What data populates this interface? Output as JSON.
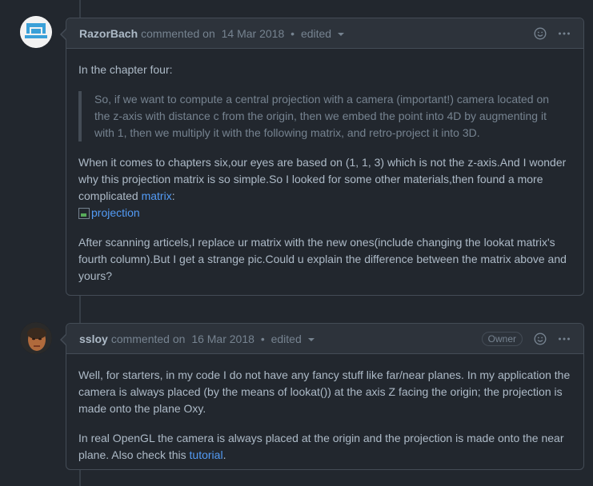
{
  "comments": [
    {
      "author": "RazorBach",
      "action": "commented on",
      "date": "14 Mar 2018",
      "separator": "•",
      "edited": "edited",
      "body": {
        "intro": "In the chapter four:",
        "quote": "So, if we want to compute a central projection with a camera (important!) camera located on the z-axis with distance c from the origin, then we embed the point into 4D by augmenting it with 1, then we multiply it with the following matrix, and retro-project it into 3D.",
        "para2_text": "When it comes to chapters six,our eyes are based on (1, 1, 3) which is not the z-axis.And I wonder why this projection matrix is so simple.So I looked for some other materials,then found a more complicated ",
        "para2_link": "matrix",
        "para2_end": ":",
        "image_alt": "projection",
        "para3": "After scanning articels,I replace ur matrix with the new ones(include changing the lookat matrix's fourth column).But I get a strange pic.Could u explain the difference between the matrix above and yours?"
      }
    },
    {
      "author": "ssloy",
      "action": "commented on",
      "date": "16 Mar 2018",
      "separator": "•",
      "edited": "edited",
      "badge": "Owner",
      "body": {
        "para1": "Well, for starters, in my code I do not have any fancy stuff like far/near planes. In my application the camera is always placed (by the means of lookat()) at the axis Z facing the origin; the projection is made onto the plane Oxy.",
        "para2_text": "In real OpenGL the camera is always placed at the origin and the projection is made onto the near plane. Also check this ",
        "para2_link": "tutorial",
        "para2_end": "."
      }
    }
  ],
  "icons": {
    "reaction": "smiley-icon",
    "more": "kebab-horizontal-icon",
    "dropdown": "triangle-down-icon"
  },
  "colors": {
    "background": "#22272e",
    "header": "#2d333b",
    "border": "#444c56",
    "link": "#539bf5",
    "text": "#adbac7",
    "muted": "#768390"
  }
}
